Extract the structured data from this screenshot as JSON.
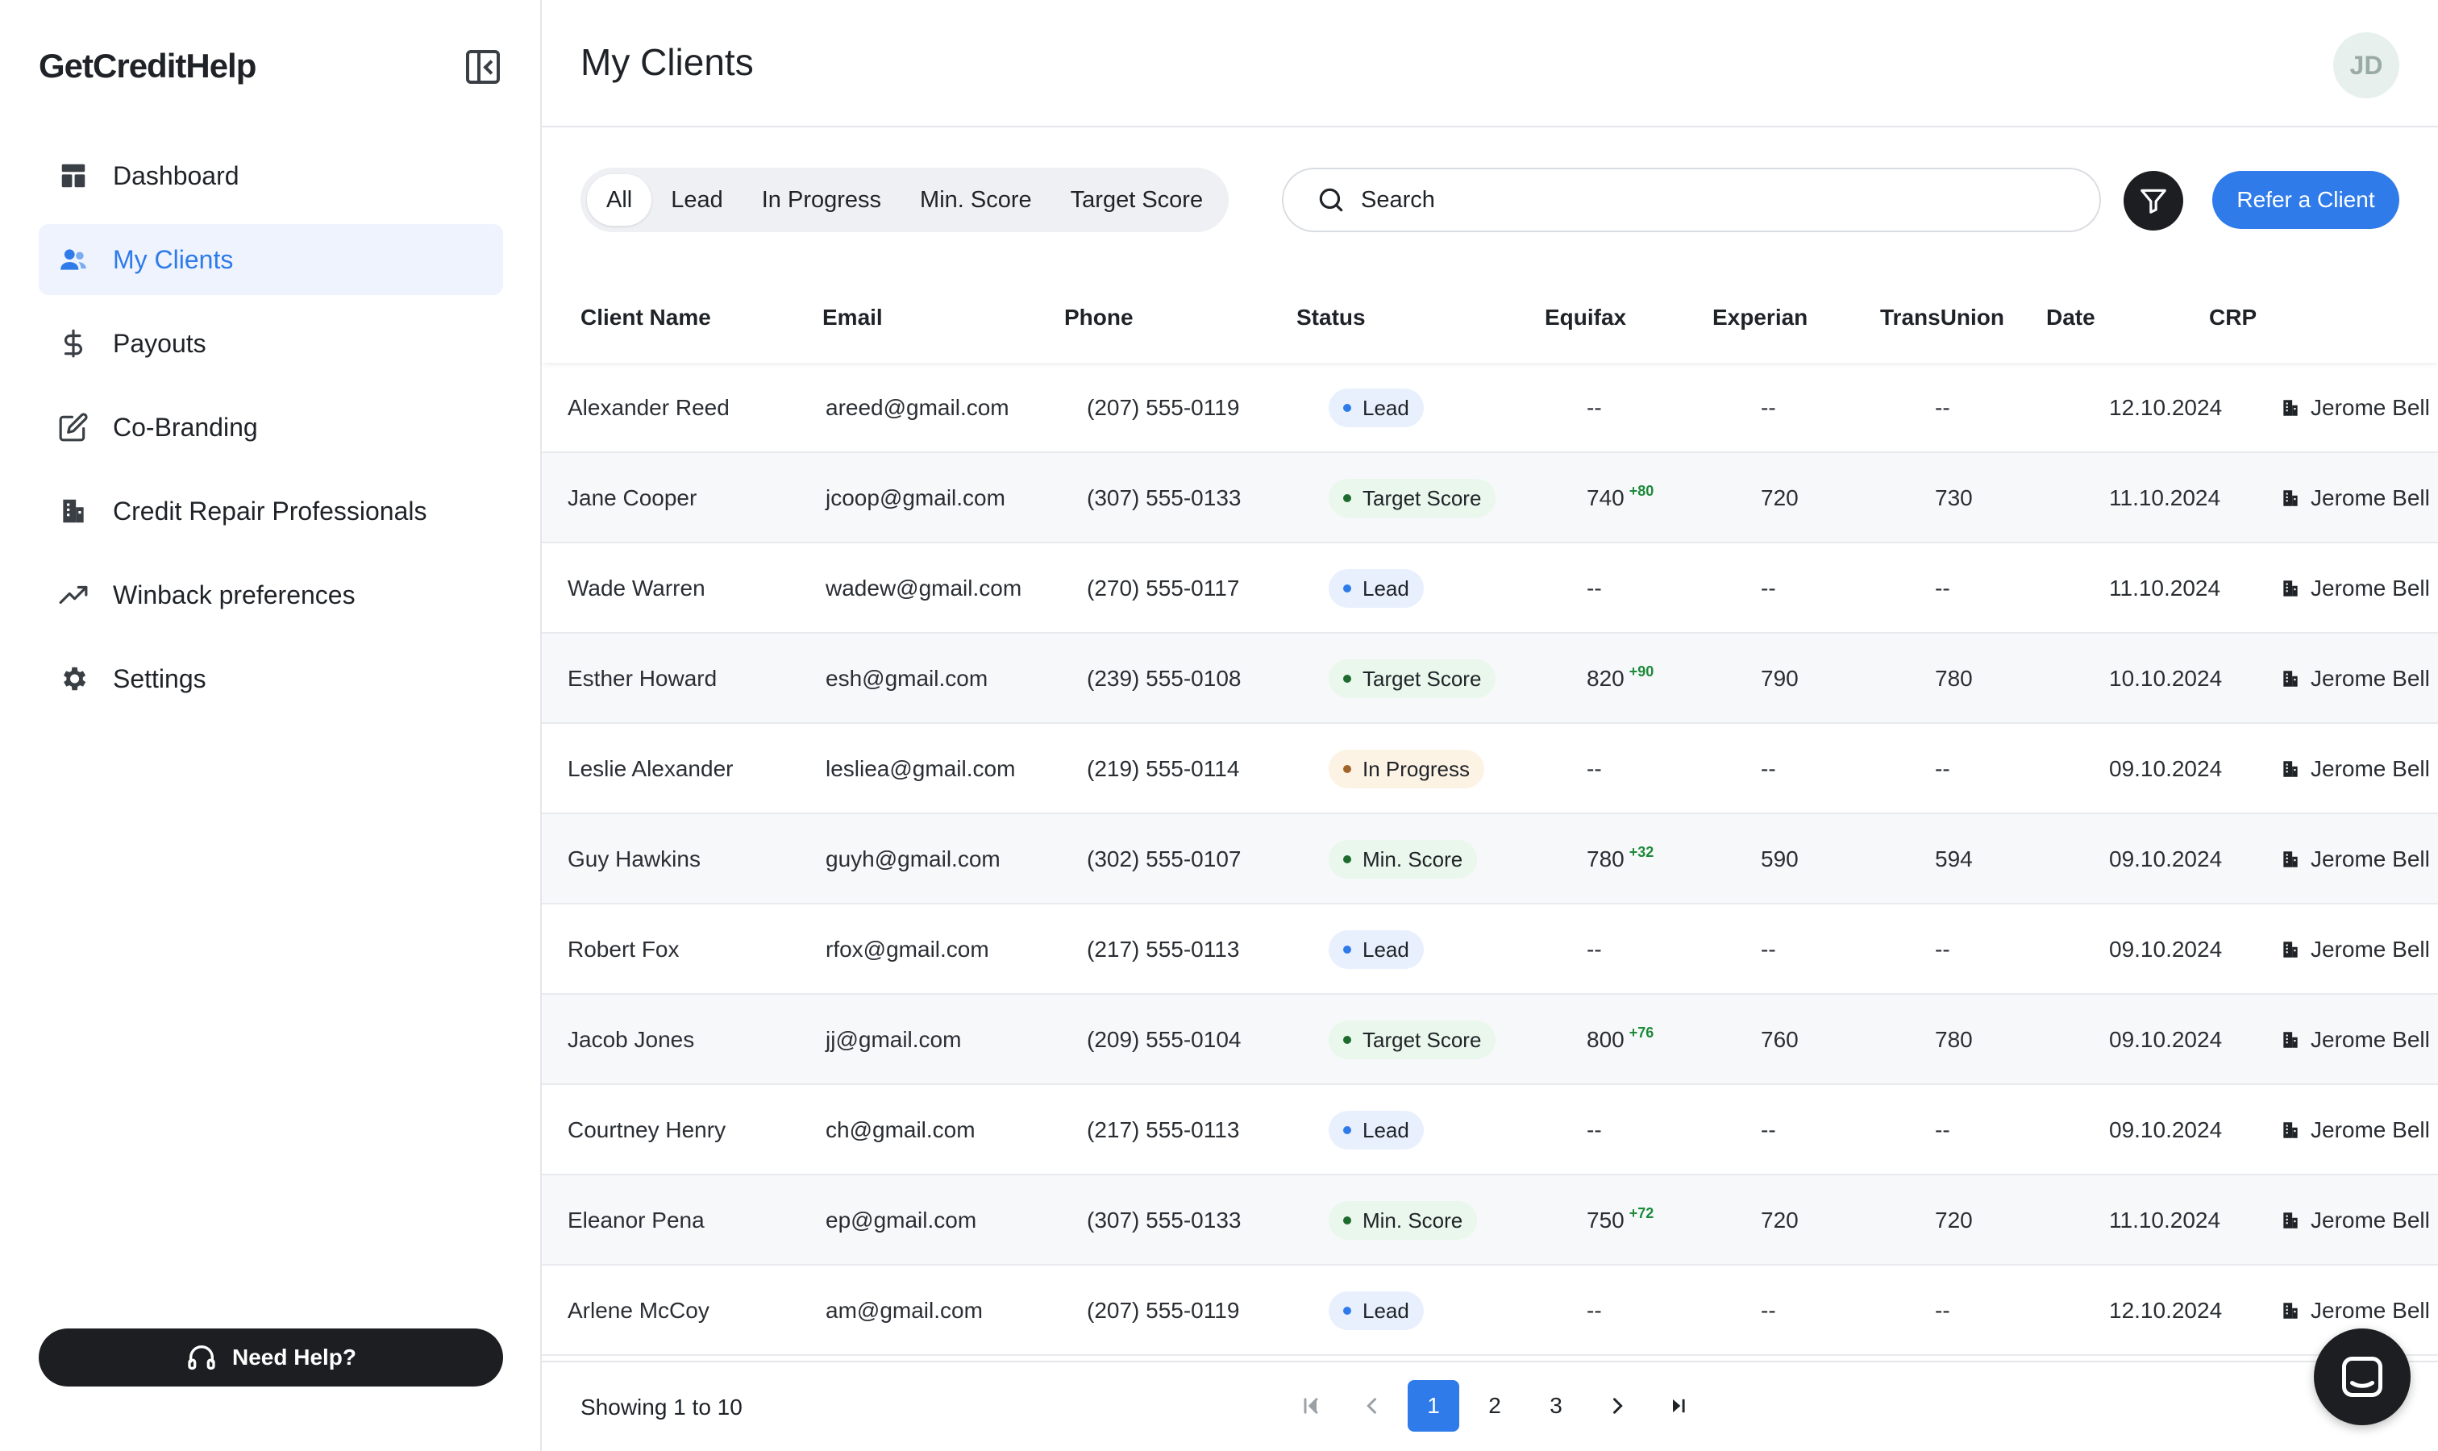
{
  "brand": {
    "logo": "GetCreditHelp"
  },
  "sidebar": {
    "items": [
      {
        "label": "Dashboard",
        "icon": "dashboard-icon"
      },
      {
        "label": "My Clients",
        "icon": "users-icon"
      },
      {
        "label": "Payouts",
        "icon": "dollar-icon"
      },
      {
        "label": "Co-Branding",
        "icon": "edit-icon"
      },
      {
        "label": "Credit Repair Professionals",
        "icon": "building-icon"
      },
      {
        "label": "Winback preferences",
        "icon": "trending-up-icon"
      },
      {
        "label": "Settings",
        "icon": "gear-icon"
      }
    ],
    "active": "My Clients",
    "help_label": "Need Help?"
  },
  "header": {
    "title": "My Clients",
    "avatar_initials": "JD"
  },
  "toolbar": {
    "tabs": [
      "All",
      "Lead",
      "In Progress",
      "Min. Score",
      "Target Score"
    ],
    "active_tab": "All",
    "search_placeholder": "Search",
    "refer_label": "Refer a Client"
  },
  "table": {
    "columns": [
      "Client Name",
      "Email",
      "Phone",
      "Status",
      "Equifax",
      "Experian",
      "TransUnion",
      "Date",
      "CRP"
    ],
    "rows": [
      {
        "name": "Alexander Reed",
        "email": "areed@gmail.com",
        "phone": "(207) 555-0119",
        "status": "Lead",
        "status_type": "lead",
        "equifax": "--",
        "equifax_delta": "",
        "experian": "--",
        "transunion": "--",
        "date": "12.10.2024",
        "crp": "Jerome Bell"
      },
      {
        "name": "Jane Cooper",
        "email": "jcoop@gmail.com",
        "phone": "(307) 555-0133",
        "status": "Target Score",
        "status_type": "target",
        "equifax": "740",
        "equifax_delta": "+80",
        "experian": "720",
        "transunion": "730",
        "date": "11.10.2024",
        "crp": "Jerome Bell"
      },
      {
        "name": "Wade Warren",
        "email": "wadew@gmail.com",
        "phone": "(270) 555-0117",
        "status": "Lead",
        "status_type": "lead",
        "equifax": "--",
        "equifax_delta": "",
        "experian": "--",
        "transunion": "--",
        "date": "11.10.2024",
        "crp": "Jerome Bell"
      },
      {
        "name": "Esther Howard",
        "email": "esh@gmail.com",
        "phone": "(239) 555-0108",
        "status": "Target Score",
        "status_type": "target",
        "equifax": "820",
        "equifax_delta": "+90",
        "experian": "790",
        "transunion": "780",
        "date": "10.10.2024",
        "crp": "Jerome Bell"
      },
      {
        "name": "Leslie Alexander",
        "email": "lesliea@gmail.com",
        "phone": "(219) 555-0114",
        "status": "In Progress",
        "status_type": "progress",
        "equifax": "--",
        "equifax_delta": "",
        "experian": "--",
        "transunion": "--",
        "date": "09.10.2024",
        "crp": "Jerome Bell"
      },
      {
        "name": "Guy Hawkins",
        "email": "guyh@gmail.com",
        "phone": "(302) 555-0107",
        "status": "Min. Score",
        "status_type": "min",
        "equifax": "780",
        "equifax_delta": "+32",
        "experian": "590",
        "transunion": "594",
        "date": "09.10.2024",
        "crp": "Jerome Bell"
      },
      {
        "name": "Robert Fox",
        "email": "rfox@gmail.com",
        "phone": "(217) 555-0113",
        "status": "Lead",
        "status_type": "lead",
        "equifax": "--",
        "equifax_delta": "",
        "experian": "--",
        "transunion": "--",
        "date": "09.10.2024",
        "crp": "Jerome Bell"
      },
      {
        "name": "Jacob Jones",
        "email": "jj@gmail.com",
        "phone": "(209) 555-0104",
        "status": "Target Score",
        "status_type": "target",
        "equifax": "800",
        "equifax_delta": "+76",
        "experian": "760",
        "transunion": "780",
        "date": "09.10.2024",
        "crp": "Jerome Bell"
      },
      {
        "name": "Courtney Henry",
        "email": "ch@gmail.com",
        "phone": "(217) 555-0113",
        "status": "Lead",
        "status_type": "lead",
        "equifax": "--",
        "equifax_delta": "",
        "experian": "--",
        "transunion": "--",
        "date": "09.10.2024",
        "crp": "Jerome Bell"
      },
      {
        "name": "Eleanor Pena",
        "email": "ep@gmail.com",
        "phone": "(307) 555-0133",
        "status": "Min. Score",
        "status_type": "min",
        "equifax": "750",
        "equifax_delta": "+72",
        "experian": "720",
        "transunion": "720",
        "date": "11.10.2024",
        "crp": "Jerome Bell"
      },
      {
        "name": "Arlene McCoy",
        "email": "am@gmail.com",
        "phone": "(207) 555-0119",
        "status": "Lead",
        "status_type": "lead",
        "equifax": "--",
        "equifax_delta": "",
        "experian": "--",
        "transunion": "--",
        "date": "12.10.2024",
        "crp": "Jerome Bell"
      }
    ]
  },
  "footer": {
    "showing": "Showing 1 to 10",
    "pages": [
      "1",
      "2",
      "3"
    ],
    "current_page": "1"
  },
  "colors": {
    "accent": "#2f7bea",
    "dark": "#1c1e21",
    "positive": "#1d8a3a"
  }
}
